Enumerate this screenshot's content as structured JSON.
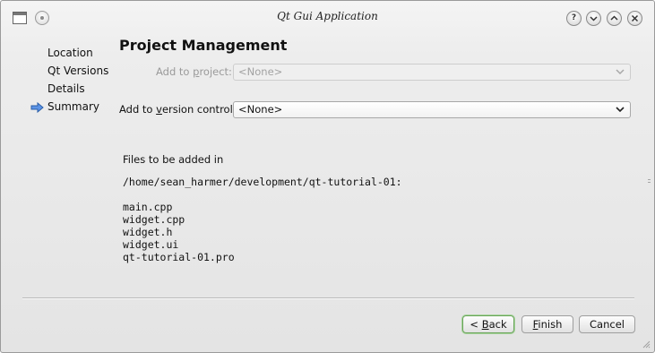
{
  "window": {
    "title": "Qt Gui Application"
  },
  "nav": {
    "items": [
      {
        "label": "Location",
        "current": false
      },
      {
        "label": "Qt Versions",
        "current": false
      },
      {
        "label": "Details",
        "current": false
      },
      {
        "label": "Summary",
        "current": true
      }
    ]
  },
  "page": {
    "heading": "Project Management"
  },
  "add_to_project": {
    "label_pre": "Add to ",
    "label_mn": "p",
    "label_post": "roject:",
    "value": "<None>",
    "enabled": false
  },
  "add_to_vcs": {
    "label_pre": "Add to ",
    "label_mn": "v",
    "label_post": "ersion control:",
    "value": "<None>",
    "enabled": true
  },
  "files": {
    "intro": "Files to be added in",
    "directory": "/home/sean_harmer/development/qt-tutorial-01:",
    "list": [
      "main.cpp",
      "widget.cpp",
      "widget.h",
      "widget.ui",
      "qt-tutorial-01.pro"
    ]
  },
  "buttons": {
    "back_pre": "< ",
    "back_mn": "B",
    "back_post": "ack",
    "finish_mn": "F",
    "finish_post": "inish",
    "cancel": "Cancel"
  },
  "icons": {
    "app": "app-window-icon",
    "pin": "pin-icon",
    "help": "help-icon",
    "minimize": "minimize-icon",
    "maximize": "maximize-icon",
    "close": "close-icon",
    "current_step": "arrow-right-icon",
    "dropdown": "chevron-down-icon"
  },
  "colors": {
    "current_arrow": "#3d7dd8",
    "default_button_border": "#6aa55a",
    "disabled_text": "#9a9a9a"
  }
}
